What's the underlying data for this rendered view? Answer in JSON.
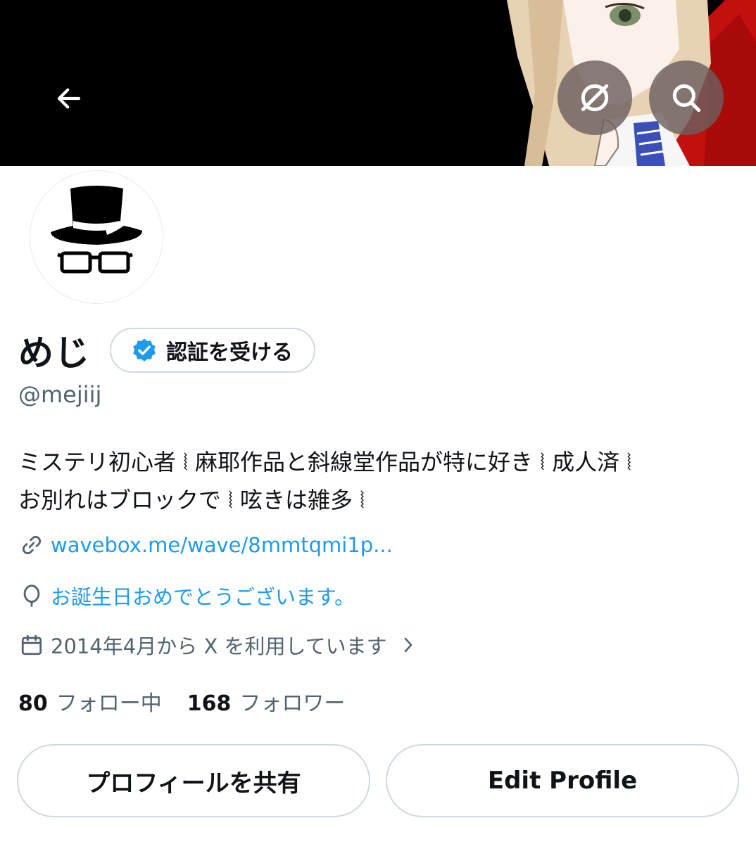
{
  "header": {
    "back_icon": "arrow-left-icon",
    "action_buttons": [
      {
        "name": "grok-button",
        "icon": "slash-circle-icon"
      },
      {
        "name": "search-button",
        "icon": "search-icon"
      }
    ]
  },
  "profile": {
    "display_name": "めじ",
    "verify_label": "認証を受ける",
    "handle": "@mejiij",
    "bio_lines": [
      "ミステリ初心者 ⦚ 麻耶作品と斜線堂作品が特に好き ⦚ 成人済 ⦚",
      "お別れはブロックで ⦚ 呟きは雑多 ⦚"
    ],
    "link": "wavebox.me/wave/8mmtqmi1p...",
    "birthday": "お誕生日おめでとうございます。",
    "joined": "2014年4月から X を利用しています"
  },
  "stats": {
    "following_count": "80",
    "following_label": "フォロー中",
    "followers_count": "168",
    "followers_label": "フォロワー"
  },
  "actions": {
    "share_label": "プロフィールを共有",
    "edit_label": "Edit Profile"
  },
  "colors": {
    "accent": "#1d9bf0",
    "secondary_text": "#536471",
    "border": "#cfd9de",
    "banner_bg": "#000000"
  }
}
